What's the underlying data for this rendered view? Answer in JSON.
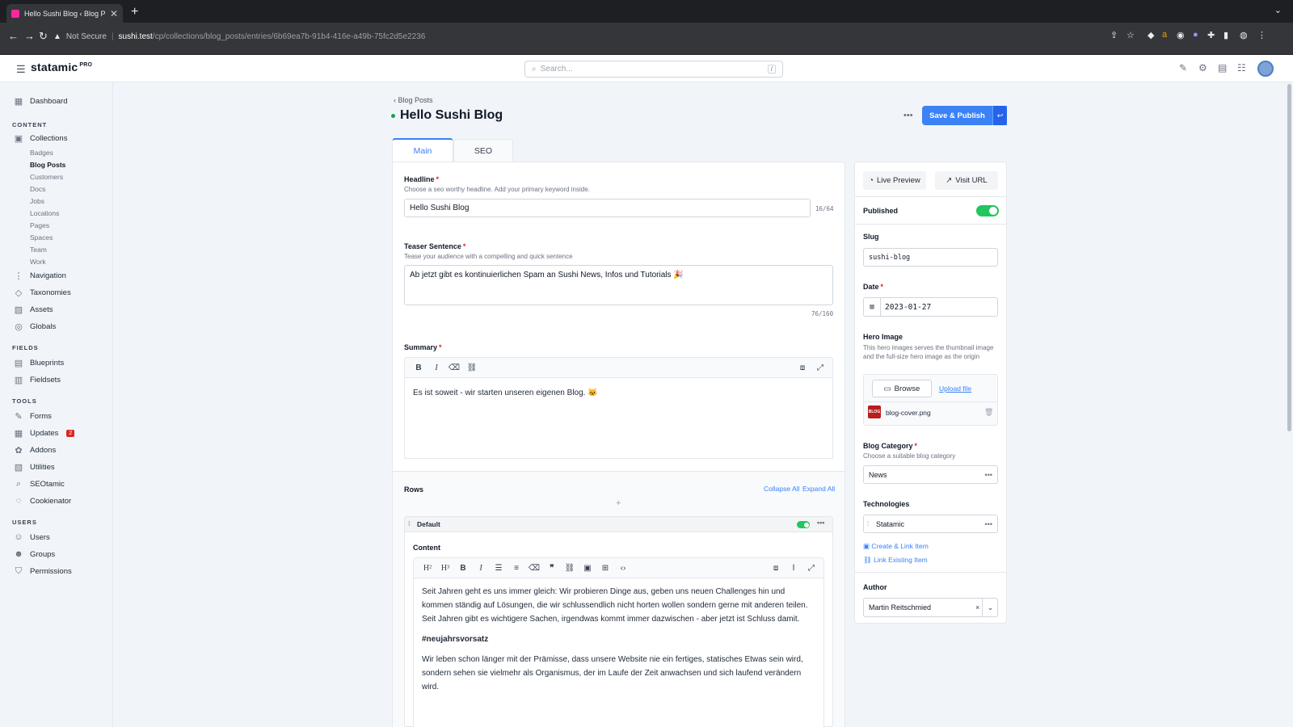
{
  "browser": {
    "tab_title": "Hello Sushi Blog ‹ Blog Posts ‹",
    "security": "Not Secure",
    "url_host": "sushi.test",
    "url_path": "/cp/collections/blog_posts/entries/6b69ea7b-91b4-416e-a49b-75fc2d5e2236"
  },
  "header": {
    "logo": "statamic",
    "logo_badge": "PRO",
    "search_placeholder": "Search...",
    "search_shortcut": "/"
  },
  "sidebar": {
    "dashboard": "Dashboard",
    "content_heading": "CONTENT",
    "collections": "Collections",
    "collection_items": [
      "Badges",
      "Blog Posts",
      "Customers",
      "Docs",
      "Jobs",
      "Locations",
      "Pages",
      "Spaces",
      "Team",
      "Work"
    ],
    "navigation": "Navigation",
    "taxonomies": "Taxonomies",
    "assets": "Assets",
    "globals": "Globals",
    "fields_heading": "FIELDS",
    "blueprints": "Blueprints",
    "fieldsets": "Fieldsets",
    "tools_heading": "TOOLS",
    "forms": "Forms",
    "updates": "Updates",
    "updates_count": "2",
    "addons": "Addons",
    "utilities": "Utilities",
    "seotamic": "SEOtamic",
    "cookienator": "Cookienator",
    "users_heading": "USERS",
    "users": "Users",
    "groups": "Groups",
    "permissions": "Permissions"
  },
  "page": {
    "breadcrumb": "‹ Blog Posts",
    "title": "Hello Sushi Blog",
    "save_label": "Save & Publish",
    "tabs": [
      "Main",
      "SEO"
    ]
  },
  "fields": {
    "headline": {
      "label": "Headline",
      "help": "Choose a seo worthy headline. Add your primary keyword inside.",
      "value": "Hello Sushi Blog",
      "counter": "16/64"
    },
    "teaser": {
      "label": "Teaser Sentence",
      "help": "Tease your audience with a compelling and quick sentence",
      "value": "Ab jetzt gibt es kontinuierlichen Spam an Sushi News, Infos und Tutorials 🎉",
      "counter": "76/160"
    },
    "summary": {
      "label": "Summary",
      "value": "Es ist soweit - wir starten unseren eigenen Blog. 🐱"
    },
    "rows": {
      "label": "Rows",
      "collapse_all": "Collapse All",
      "expand_all": "Expand All",
      "set_name": "Default",
      "content_label": "Content",
      "paragraph_1": "Seit Jahren geht es uns immer gleich: Wir probieren Dinge aus, geben uns neuen Challenges hin und kommen ständig auf Lösungen, die wir schlussendlich nicht horten wollen sondern gerne mit anderen teilen. Seit Jahren gibt es wichtigere Sachen, irgendwas kommt immer dazwischen - aber jetzt ist Schluss damit.",
      "hashtag": "#neujahrsvorsatz",
      "paragraph_2": "Wir leben schon länger mit der Prämisse, dass unsere Website nie ein fertiges, statisches Etwas sein wird, sondern sehen sie vielmehr als Organismus, der im Laufe der Zeit anwachsen und sich laufend verändern wird."
    }
  },
  "side": {
    "live_preview": "Live Preview",
    "visit_url": "Visit URL",
    "published_label": "Published",
    "slug_label": "Slug",
    "slug_value": "sushi-blog",
    "date_label": "Date",
    "date_value": "2023-01-27",
    "hero_label": "Hero Image",
    "hero_help": "This hero images serves the thumbnail image and the full-size hero image as the origin",
    "browse": "Browse",
    "upload": "Upload file",
    "file_name": "blog-cover.png",
    "file_thumb": "BLOG",
    "category_label": "Blog Category",
    "category_help": "Choose a suitable blog category",
    "category_value": "News",
    "tech_label": "Technologies",
    "tech_value": "Statamic",
    "create_link": "Create & Link Item",
    "link_existing": "Link Existing Item",
    "author_label": "Author",
    "author_value": "Martin Reitschmied"
  },
  "colors": {
    "accent": "#3b82f6",
    "success": "#22c55e",
    "danger": "#dc2626"
  }
}
